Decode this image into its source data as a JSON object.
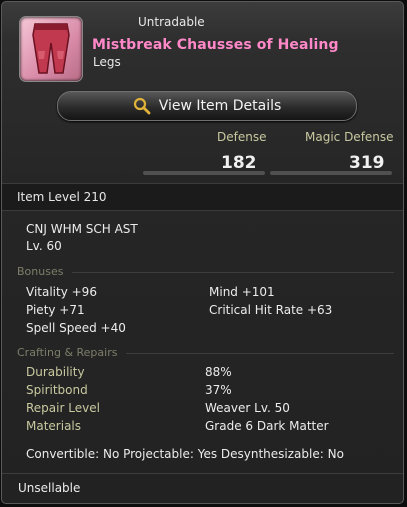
{
  "item": {
    "tradability": "Untradable",
    "name": "Mistbreak Chausses of Healing",
    "slot": "Legs",
    "icon": "legs-armor-icon"
  },
  "view_button": {
    "label": "View Item Details",
    "icon": "magnifier-icon"
  },
  "stats": {
    "defense_label": "Defense",
    "defense_value": "182",
    "magic_defense_label": "Magic Defense",
    "magic_defense_value": "319"
  },
  "item_level": "Item Level 210",
  "jobs": "CNJ WHM SCH AST",
  "level": "Lv. 60",
  "bonuses": {
    "title": "Bonuses",
    "left": [
      "Vitality +96",
      "Piety +71",
      "Spell Speed +40"
    ],
    "right": [
      "Mind +101",
      "Critical Hit Rate +63"
    ]
  },
  "crafting": {
    "title": "Crafting & Repairs",
    "rows": [
      {
        "key": "Durability",
        "value": "88%"
      },
      {
        "key": "Spiritbond",
        "value": "37%"
      },
      {
        "key": "Repair Level",
        "value": "Weaver Lv. 50"
      },
      {
        "key": "Materials",
        "value": "Grade 6 Dark Matter"
      }
    ],
    "flags": "Convertible: No Projectable: Yes Desynthesizable: No"
  },
  "footer": "Unsellable",
  "colors": {
    "name": "#ff88c8",
    "label": "#c9c9a0",
    "section": "#7e7e6a"
  }
}
